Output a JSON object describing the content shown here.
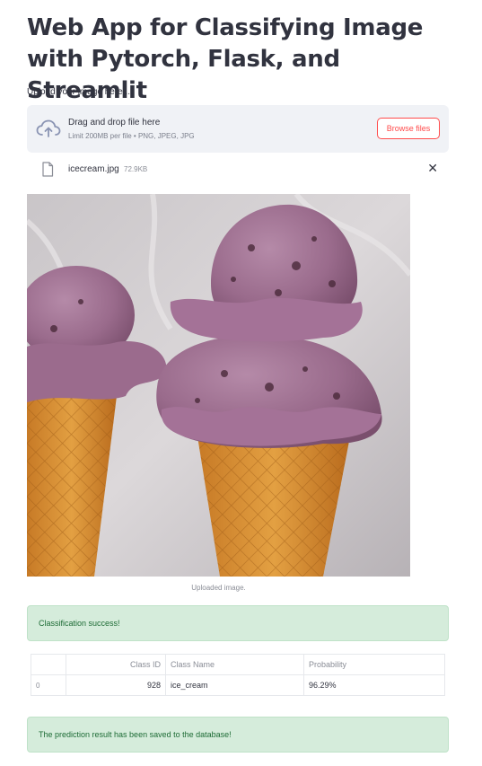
{
  "page": {
    "title": "Web App for Classifying Image with Pytorch, Flask, and Streamlit"
  },
  "uploader": {
    "label": "Upload your image here ...",
    "drop_title": "Drag and drop file here",
    "drop_subtitle": "Limit 200MB per file • PNG, JPEG, JPG",
    "browse_label": "Browse files",
    "file_name": "icecream.jpg",
    "file_size": "72.9KB",
    "remove_icon": "close-icon"
  },
  "image": {
    "caption": "Uploaded image."
  },
  "alerts": {
    "success": "Classification success!",
    "saved": "The prediction result has been saved to the database!"
  },
  "results_table": {
    "columns": [
      "",
      "Class ID",
      "Class Name",
      "Probability"
    ],
    "rows": [
      {
        "index": "0",
        "class_id": "928",
        "class_name": "ice_cream",
        "probability": "96.29%"
      }
    ]
  },
  "colors": {
    "accent": "#ff4b4b",
    "success_bg": "#d5ecdb",
    "success_text": "#1d6b35",
    "dropzone_bg": "#f0f2f6"
  }
}
